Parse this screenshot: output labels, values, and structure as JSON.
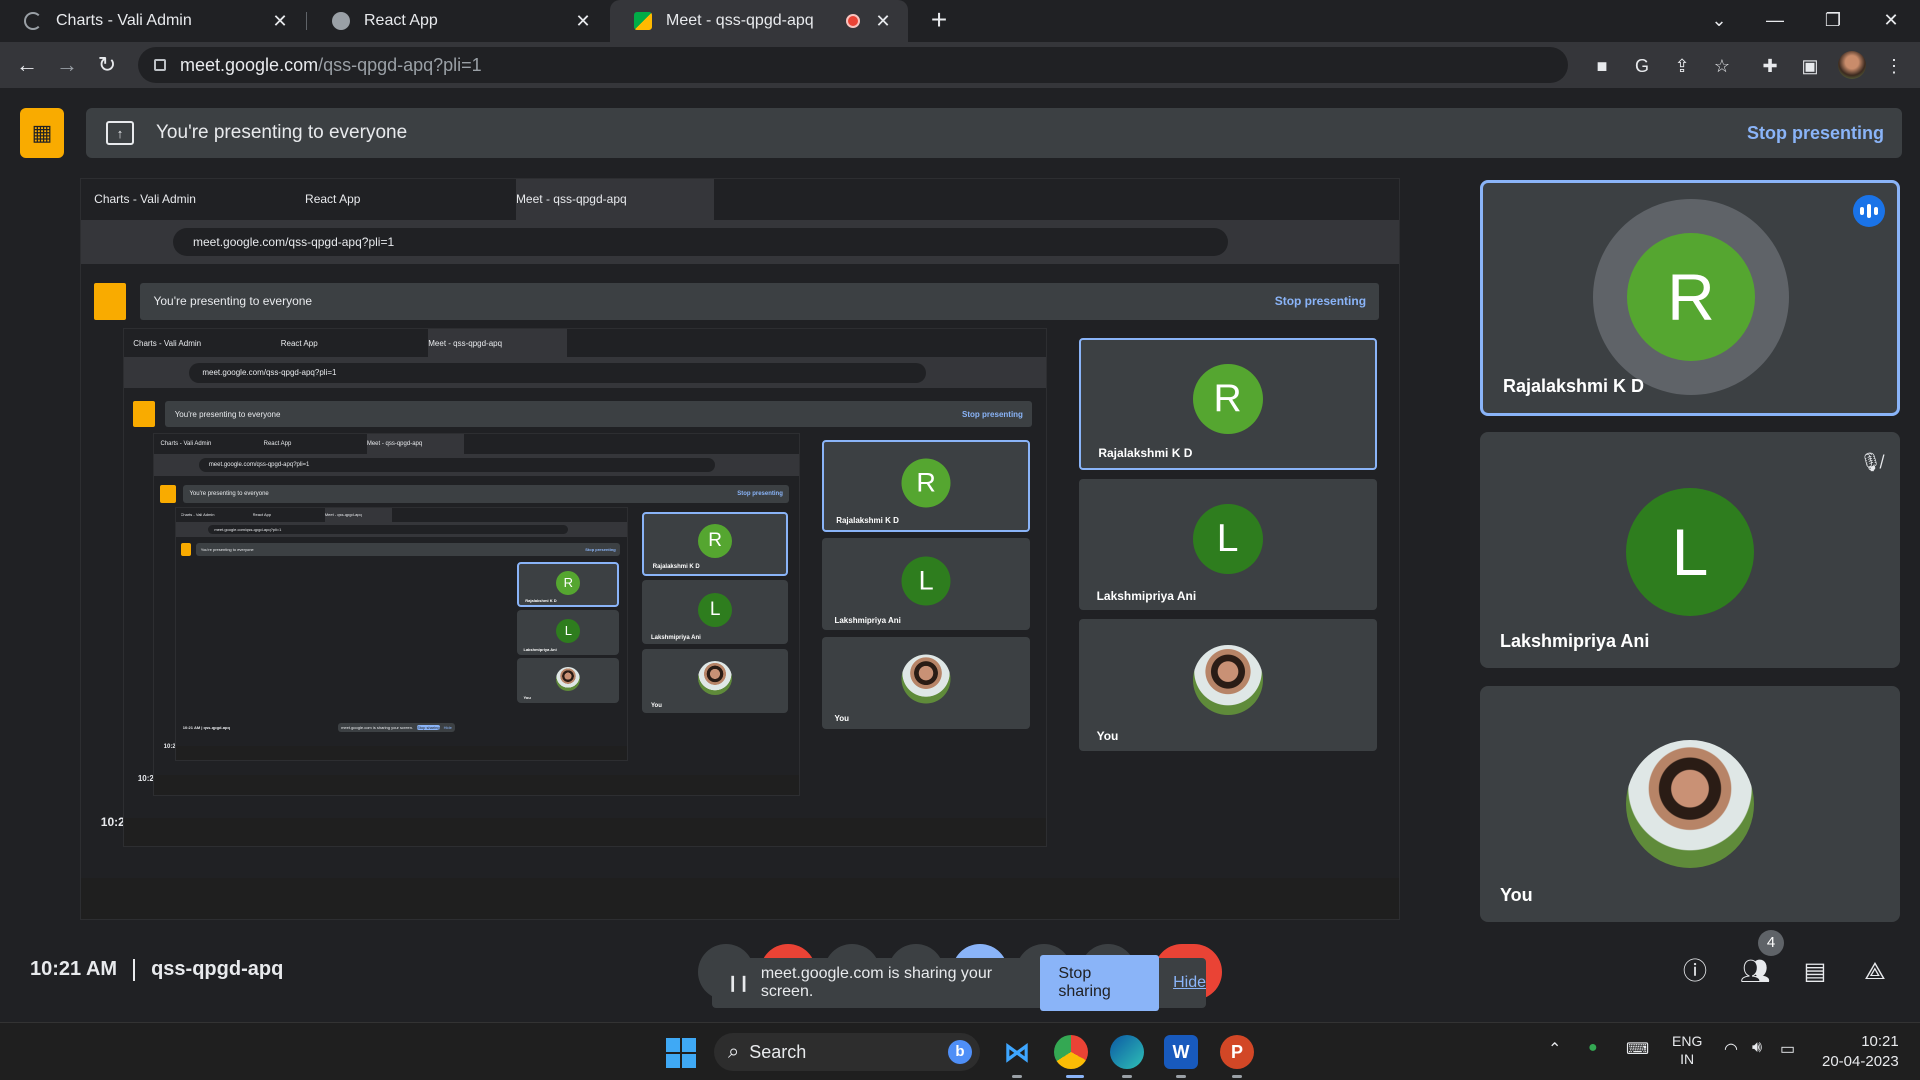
{
  "browser": {
    "tabs": [
      {
        "title": "Charts - Vali Admin",
        "close": "✕",
        "active": false
      },
      {
        "title": "React App",
        "close": "✕",
        "active": false
      },
      {
        "title": "Meet - qss-qpgd-apq",
        "close": "✕",
        "active": true,
        "recording": true
      }
    ],
    "new_tab_glyph": "+",
    "window_controls": [
      "⌄",
      "—",
      "❐",
      "✕"
    ],
    "url_host": "meet.google.com",
    "url_path": "/qss-qpgd-apq?pli=1"
  },
  "banner": {
    "text": "You're presenting to everyone",
    "stop_label": "Stop presenting"
  },
  "participants": [
    {
      "name": "Rajalakshmi K D",
      "initial": "R",
      "color": "#55a630",
      "speaking": true,
      "muted": false
    },
    {
      "name": "Lakshmipriya Ani",
      "initial": "L",
      "color": "#2e7d1e",
      "speaking": false,
      "muted": true
    },
    {
      "name": "You",
      "initial": "",
      "photo": true,
      "speaking": false,
      "muted": false
    }
  ],
  "meeting": {
    "time": "10:21 AM",
    "code": "qss-qpgd-apq",
    "people_count": "4"
  },
  "sharing": {
    "message": "meet.google.com is sharing your screen.",
    "stop_label": "Stop sharing",
    "hide_label": "Hide"
  },
  "taskbar": {
    "search_label": "Search",
    "lang": "ENG",
    "region": "IN",
    "time": "10:21",
    "date": "20-04-2023"
  },
  "icons": {
    "info": "info-icon",
    "people": "people-icon",
    "chat": "chat-icon",
    "activities": "activities-icon"
  }
}
